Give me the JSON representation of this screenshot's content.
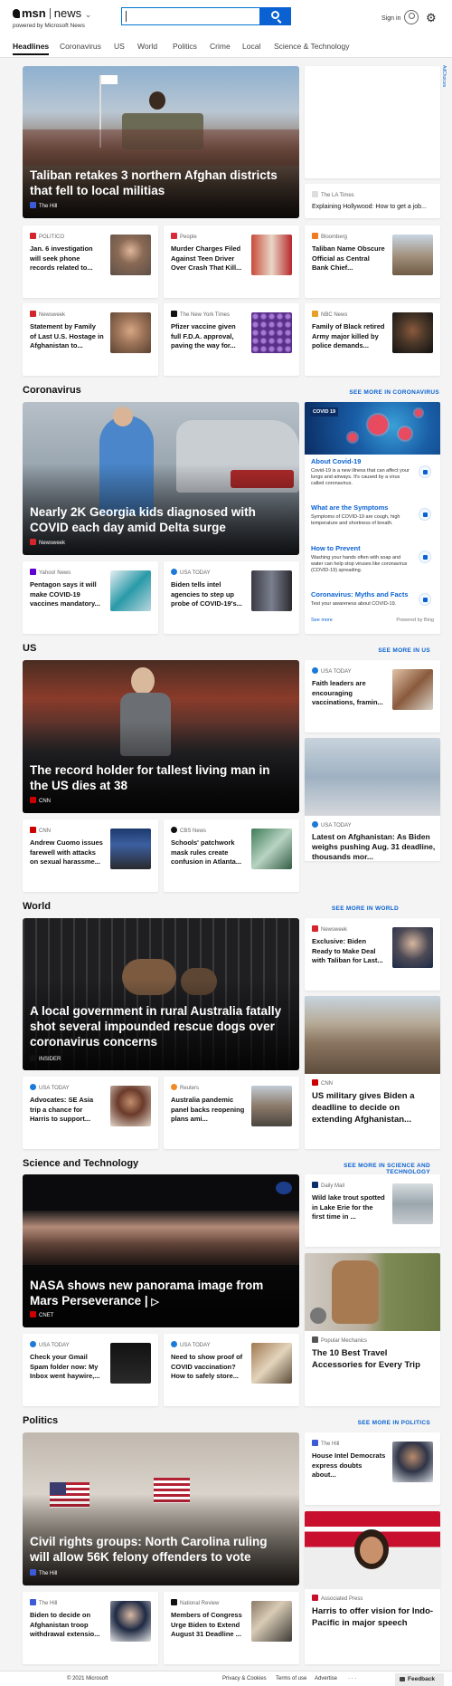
{
  "header": {
    "brand": "msn",
    "brand_product": "news",
    "powered_by": "powered by Microsoft News",
    "sign_in": "Sign in",
    "search_value": ""
  },
  "nav": [
    "Headlines",
    "Coronavirus",
    "US",
    "World",
    "Politics",
    "Crime",
    "Local",
    "Science & Technology"
  ],
  "ad_label": "AdChoices",
  "headlines": {
    "hero": {
      "title": "Taliban retakes 3 northern Afghan districts that fell to local militias",
      "source": "The Hill"
    },
    "ad": {
      "source": "The LA Times",
      "title": "Explaining Hollywood: How to get a job..."
    },
    "cards": [
      {
        "source": "POLITICO",
        "title": "Jan. 6 investigation will seek phone records related to..."
      },
      {
        "source": "People",
        "title": "Murder Charges Filed Against Teen Driver Over Crash That Kill..."
      },
      {
        "source": "Bloomberg",
        "title": "Taliban Name Obscure Official as Central Bank Chief..."
      },
      {
        "source": "Newsweek",
        "title": "Statement by Family of Last U.S. Hostage in Afghanistan to..."
      },
      {
        "source": "The New York Times",
        "title": "Pfizer vaccine given full F.D.A. approval, paving the way for..."
      },
      {
        "source": "NBC News",
        "title": "Family of Black retired Army major killed by police demands..."
      }
    ]
  },
  "coronavirus": {
    "heading": "Coronavirus",
    "see_more": "SEE MORE IN CORONAVIRUS",
    "hero": {
      "title": "Nearly 2K Georgia kids diagnosed with COVID each day amid Delta surge",
      "source": "Newsweek"
    },
    "cards": [
      {
        "source": "Yahoo! News",
        "title": "Pentagon says it will make COVID-19 vaccines mandatory..."
      },
      {
        "source": "USA TODAY",
        "title": "Biden tells intel agencies to step up probe of COVID-19's..."
      }
    ],
    "panel": {
      "badge": "COVID 19",
      "items": [
        {
          "title": "About Covid-19",
          "desc": "Covid-19 is a new illness that can affect your lungs and airways. It's caused by a virus called coronavirus."
        },
        {
          "title": "What are the Symptoms",
          "desc": "Symptoms of COVID-19 are cough, high temperature and shortness of breath."
        },
        {
          "title": "How to Prevent",
          "desc": "Washing your hands often with soap and water can help stop viruses like coronavirus (COVID-19) spreading."
        },
        {
          "title": "Coronavirus: Myths and Facts",
          "desc": "Test your awareness about COVID-19."
        }
      ],
      "see_more": "See more",
      "powered": "Powered by Bing"
    }
  },
  "us": {
    "heading": "US",
    "see_more": "SEE MORE IN US",
    "hero": {
      "title": "The record holder for tallest living man in the US dies at 38",
      "source": "CNN"
    },
    "side1": {
      "source": "USA TODAY",
      "title": "Faith leaders are encouraging vaccinations, framin..."
    },
    "side2": {
      "source": "USA TODAY",
      "title": "Latest on Afghanistan: As Biden weighs pushing Aug. 31 deadline, thousands mor..."
    },
    "cards": [
      {
        "source": "CNN",
        "title": "Andrew Cuomo issues farewell with attacks on sexual harassme..."
      },
      {
        "source": "CBS News",
        "title": "Schools' patchwork mask rules create confusion in Atlanta..."
      }
    ]
  },
  "world": {
    "heading": "World",
    "see_more": "SEE MORE IN WORLD",
    "hero": {
      "title": "A local government in rural Australia fatally shot several impounded rescue dogs over coronavirus concerns",
      "source": "INSIDER"
    },
    "side1": {
      "source": "Newsweek",
      "title": "Exclusive: Biden Ready to Make Deal with Taliban for Last..."
    },
    "side2": {
      "source": "CNN",
      "title": "US military gives Biden a deadline to decide on extending Afghanistan..."
    },
    "cards": [
      {
        "source": "USA TODAY",
        "title": "Advocates: SE Asia trip a chance for Harris to support..."
      },
      {
        "source": "Reuters",
        "title": "Australia pandemic panel backs reopening plans ami..."
      }
    ]
  },
  "science": {
    "heading": "Science and Technology",
    "see_more": "SEE MORE IN SCIENCE AND TECHNOLOGY",
    "hero": {
      "title": "NASA shows new panorama image from Mars Perseverance |",
      "source": "CNET"
    },
    "side1": {
      "source": "Daily Mail",
      "title": "Wild lake trout spotted in Lake Erie for the first time in ..."
    },
    "side2": {
      "source": "Popular Mechanics",
      "title": "The 10 Best Travel Accessories for Every Trip"
    },
    "cards": [
      {
        "source": "USA TODAY",
        "title": "Check your Gmail Spam folder now: My Inbox went haywire,..."
      },
      {
        "source": "USA TODAY",
        "title": "Need to show proof of COVID vaccination? How to safely store..."
      }
    ]
  },
  "politics": {
    "heading": "Politics",
    "see_more": "SEE MORE IN POLITICS",
    "hero": {
      "title": "Civil rights groups: North Carolina ruling will allow 56K felony offenders to vote",
      "source": "The Hill"
    },
    "side1": {
      "source": "The Hill",
      "title": "House Intel Democrats express doubts about..."
    },
    "side2": {
      "source": "Associated Press",
      "title": "Harris to offer vision for Indo-Pacific in major speech"
    },
    "cards": [
      {
        "source": "The Hill",
        "title": "Biden to decide on Afghanistan troop withdrawal extensio..."
      },
      {
        "source": "National Review",
        "title": "Members of Congress Urge Biden to Extend August 31 Deadline ..."
      }
    ]
  },
  "footer": {
    "copyright": "© 2021 Microsoft",
    "links": [
      "Privacy & Cookies",
      "Terms of use",
      "Advertise"
    ],
    "more": "· · ·",
    "feedback": "Feedback"
  },
  "colors": {
    "accent": "#0a62d2",
    "page_bg": "#f4f4f4"
  }
}
